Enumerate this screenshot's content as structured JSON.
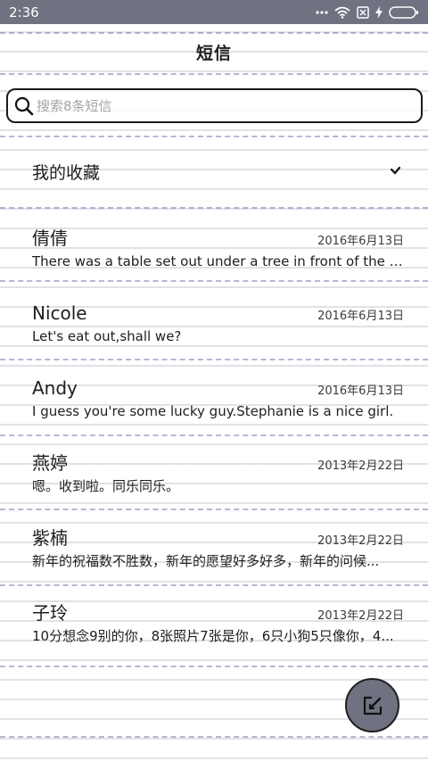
{
  "status_bar": {
    "time": "2:36",
    "icons": [
      "signal-dots-icon",
      "wifi-icon",
      "sim-error-icon",
      "charging-icon",
      "battery-icon"
    ]
  },
  "header": {
    "title": "短信"
  },
  "search": {
    "placeholder": "搜索8条短信",
    "value": ""
  },
  "favorites": {
    "label": "我的收藏",
    "icon": "chevron-down-icon"
  },
  "messages": [
    {
      "name": "倩倩",
      "date": "2016年6月13日",
      "preview": "There was a table set out under a tree in front of the ho..."
    },
    {
      "name": "Nicole",
      "date": "2016年6月13日",
      "preview": "Let's eat out,shall we?"
    },
    {
      "name": "Andy",
      "date": "2016年6月13日",
      "preview": "I guess you're some lucky guy.Stephanie is a nice girl."
    },
    {
      "name": "燕婷",
      "date": "2013年2月22日",
      "preview": "嗯。收到啦。同乐同乐。"
    },
    {
      "name": "紫楠",
      "date": "2013年2月22日",
      "preview": "新年的祝福数不胜数，新年的愿望好多好多，新年的问候..."
    },
    {
      "name": "子玲",
      "date": "2013年2月22日",
      "preview": "10分想念9别的你，8张照片7张是你，6只小狗5只像你，4..."
    }
  ],
  "fab": {
    "icon": "compose-icon"
  },
  "colors": {
    "accent": "#6f7280",
    "ink": "#1e1e1e",
    "dash": "#787caa"
  }
}
